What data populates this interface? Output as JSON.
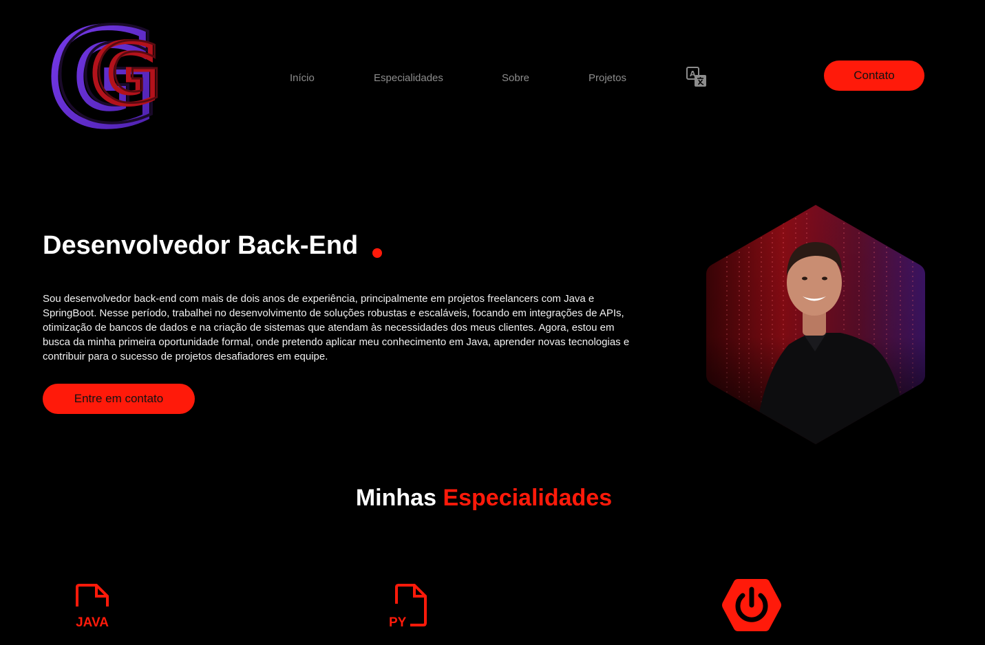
{
  "header": {
    "logo_letter": "G",
    "nav": [
      {
        "label": "Início"
      },
      {
        "label": "Especialidades"
      },
      {
        "label": "Sobre"
      },
      {
        "label": "Projetos"
      }
    ],
    "translate_icon": "translate-icon",
    "contact_label": "Contato"
  },
  "hero": {
    "title": "Desenvolvedor Back-End",
    "description": "Sou desenvolvedor back-end com mais de dois anos de experiência, principalmente em projetos freelancers com Java e SpringBoot. Nesse período, trabalhei no desenvolvimento de soluções robustas e escaláveis, focando em integrações de APIs, otimização de bancos de dados e na criação de sistemas que atendam às necessidades dos meus clientes. Agora, estou em busca da minha primeira oportunidade formal, onde pretendo aplicar meu conhecimento em Java, aprender novas tecnologias e contribuir para o sucesso de projetos desafiadores em equipe.",
    "cta_label": "Entre em contato"
  },
  "specialties": {
    "title_plain": "Minhas",
    "title_accent": "Especialidades",
    "items": [
      {
        "icon": "java-file-icon",
        "label": "JAVA"
      },
      {
        "icon": "python-file-icon",
        "label": "PY"
      },
      {
        "icon": "spring-boot-icon"
      }
    ]
  },
  "colors": {
    "accent": "#ff1a0a",
    "background": "#000000",
    "nav_text": "#8d8d8d",
    "logo_purple": "#6a2fd6",
    "logo_red": "#b3121b"
  }
}
